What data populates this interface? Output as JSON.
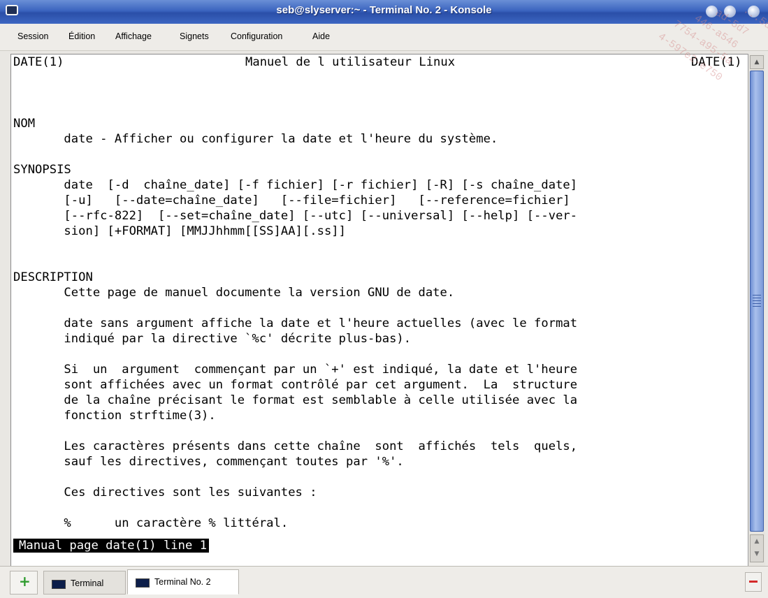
{
  "window": {
    "title": "seb@slyserver:~ - Terminal No. 2 - Konsole"
  },
  "menubar": {
    "items": [
      "Session",
      "Édition",
      "Affichage",
      "Signets",
      "Configuration",
      "Aide"
    ]
  },
  "man_page": {
    "header_left": "DATE(1)",
    "header_center": "Manuel de l utilisateur Linux",
    "header_right": "DATE(1)",
    "body": "\n\n\n\nNOM\n       date - Afficher ou configurer la date et l'heure du système.\n\nSYNOPSIS\n       date  [-d  chaîne_date] [-f fichier] [-r fichier] [-R] [-s chaîne_date]\n       [-u]   [--date=chaîne_date]   [--file=fichier]   [--reference=fichier]\n       [--rfc-822]  [--set=chaîne_date] [--utc] [--universal] [--help] [--ver-\n       sion] [+FORMAT] [MMJJhhmm[[SS]AA][.ss]]\n\n\nDESCRIPTION\n       Cette page de manuel documente la version GNU de date.\n\n       date sans argument affiche la date et l'heure actuelles (avec le format\n       indiqué par la directive `%c' décrite plus-bas).\n\n       Si  un  argument  commençant par un `+' est indiqué, la date et l'heure\n       sont affichées avec un format contrôlé par cet argument.  La  structure\n       de la chaîne précisant le format est semblable à celle utilisée avec la\n       fonction strftime(3).\n\n       Les caractères présents dans cette chaîne  sont  affichés  tels  quels,\n       sauf les directives, commençant toutes par '%'.\n\n       Ces directives sont les suivantes :\n\n       %      un caractère % littéral.",
    "status_line": "Manual page date(1) line 1"
  },
  "tabs": [
    {
      "label": "Terminal",
      "active": false
    },
    {
      "label": "Terminal No. 2",
      "active": true
    }
  ],
  "watermark": [
    "ad-5d7",
    "446-a546",
    "7754-a95-5a",
    "4-597e2-e750",
    "...5da"
  ]
}
